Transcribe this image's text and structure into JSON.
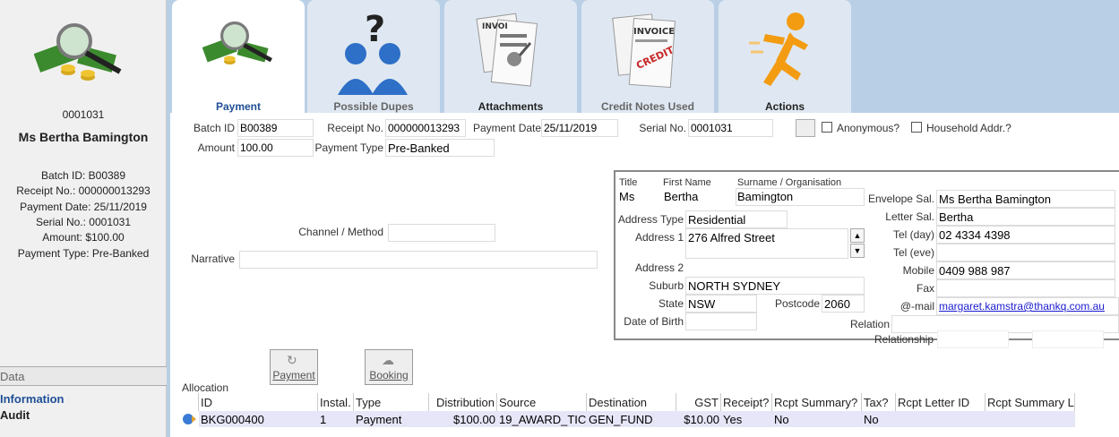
{
  "sidebar": {
    "serial": "0001031",
    "name": "Ms Bertha Bamington",
    "details": [
      "Batch ID: B00389",
      "Receipt No.: 000000013293",
      "Payment Date: 25/11/2019",
      "Serial No.: 0001031",
      "Amount: $100.00",
      "Payment Type: Pre-Banked"
    ],
    "data_header": "Data",
    "links": [
      "Information",
      "Audit"
    ]
  },
  "tabs": [
    {
      "label": "Payment",
      "icon": "money-magnifier-icon",
      "active": true
    },
    {
      "label": "Possible Dupes",
      "icon": "people-question-icon",
      "active": false
    },
    {
      "label": "Attachments",
      "icon": "paperclip-document-icon",
      "active": false
    },
    {
      "label": "Credit Notes Used",
      "icon": "invoice-credit-icon",
      "active": false
    },
    {
      "label": "Actions",
      "icon": "running-man-icon",
      "active": false
    }
  ],
  "form": {
    "batch_id_label": "Batch ID",
    "batch_id": "B00389",
    "receipt_no_label": "Receipt No.",
    "receipt_no": "000000013293",
    "payment_date_label": "Payment Date",
    "payment_date": "25/11/2019",
    "serial_no_label": "Serial No.",
    "serial_no": "0001031",
    "anonymous_label": "Anonymous?",
    "household_label": "Household Addr.?",
    "amount_label": "Amount",
    "amount": "100.00",
    "payment_type_label": "Payment Type",
    "payment_type": "Pre-Banked",
    "channel_label": "Channel / Method",
    "channel": "",
    "narrative_label": "Narrative",
    "narrative": ""
  },
  "contact": {
    "title_label": "Title",
    "title": "Ms",
    "first_name_label": "First Name",
    "first_name": "Bertha",
    "surname_label": "Surname / Organisation",
    "surname": "Bamington",
    "address_type_label": "Address Type",
    "address_type": "Residential",
    "address1_label": "Address 1",
    "address1": "276 Alfred Street",
    "address2_label": "Address 2",
    "address2": "",
    "suburb_label": "Suburb",
    "suburb": "NORTH SYDNEY",
    "state_label": "State",
    "state": "NSW",
    "postcode_label": "Postcode",
    "postcode": "2060",
    "dob_label": "Date of Birth",
    "dob": "",
    "envelope_label": "Envelope Sal.",
    "envelope": "Ms Bertha Bamington",
    "letter_label": "Letter Sal.",
    "letter": "Bertha",
    "tel_day_label": "Tel (day)",
    "tel_day": "02 4334 4398",
    "tel_eve_label": "Tel (eve)",
    "tel_eve": "",
    "mobile_label": "Mobile",
    "mobile": "0409 988 987",
    "fax_label": "Fax",
    "fax": "",
    "email_label": "@-mail",
    "email": "margaret.kamstra@thankq.com.au",
    "relation_label": "Relation",
    "relation": "",
    "relationship_label": "Relationship",
    "relationship": ""
  },
  "buttons": {
    "payment": "Payment",
    "booking": "Booking"
  },
  "allocation": {
    "label": "Allocation",
    "columns": [
      "ID",
      "Instal.",
      "Type",
      "Distribution",
      "Source",
      "Destination",
      "GST",
      "Receipt?",
      "Rcpt Summary?",
      "Tax?",
      "Rcpt Letter ID",
      "Rcpt Summary L"
    ],
    "rows": [
      [
        "BKG000400",
        "1",
        "Payment",
        "$100.00",
        "19_AWARD_TIC",
        "GEN_FUND",
        "$10.00",
        "Yes",
        "No",
        "No",
        "",
        ""
      ]
    ]
  }
}
